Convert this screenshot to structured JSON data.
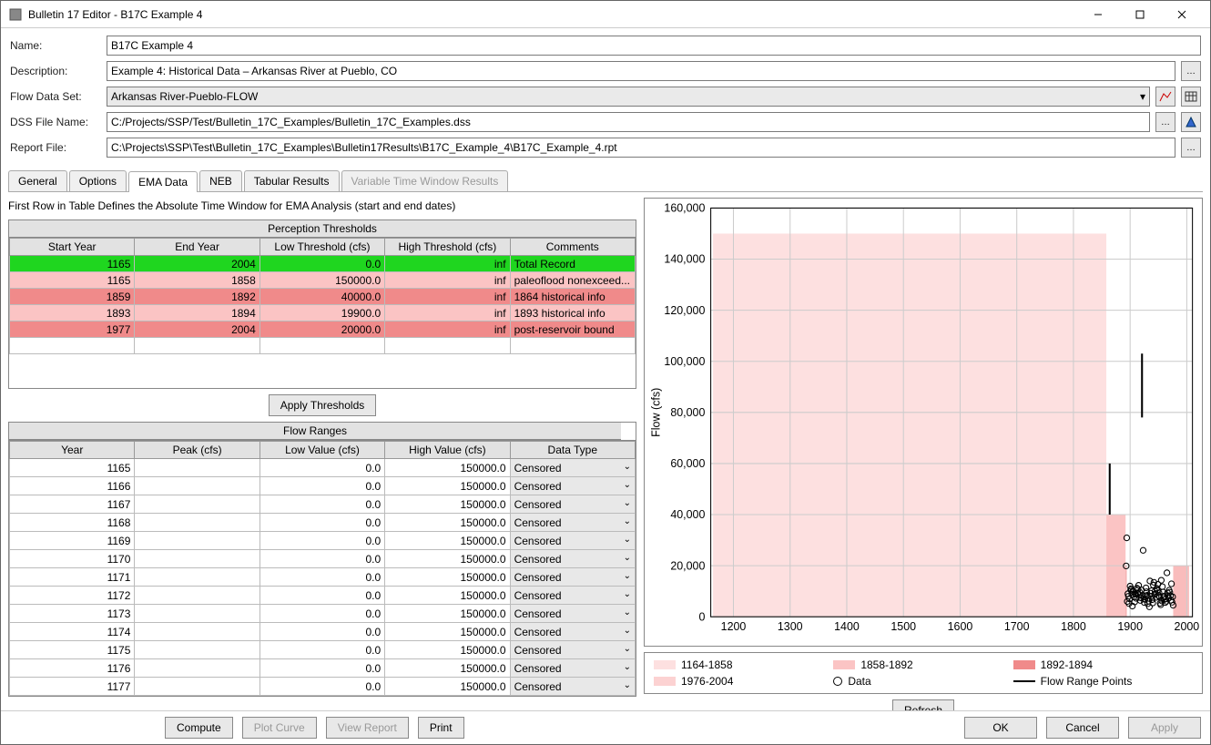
{
  "window": {
    "title": "Bulletin 17 Editor - B17C Example 4"
  },
  "form": {
    "name_label": "Name:",
    "name_value": "B17C Example 4",
    "desc_label": "Description:",
    "desc_value": "Example 4: Historical Data – Arkansas River at Pueblo, CO",
    "flowds_label": "Flow Data Set:",
    "flowds_value": "Arkansas River-Pueblo-FLOW",
    "dss_label": "DSS File Name:",
    "dss_value": "C:/Projects/SSP/Test/Bulletin_17C_Examples/Bulletin_17C_Examples.dss",
    "report_label": "Report File:",
    "report_value": "C:\\Projects\\SSP\\Test\\Bulletin_17C_Examples\\Bulletin17Results\\B17C_Example_4\\B17C_Example_4.rpt"
  },
  "tabs": {
    "t0": "General",
    "t1": "Options",
    "t2": "EMA Data",
    "t3": "NEB",
    "t4": "Tabular Results",
    "t5": "Variable Time Window Results"
  },
  "ema": {
    "caption": "First Row in Table Defines the Absolute Time Window for EMA Analysis (start and end dates)",
    "pt_title": "Perception Thresholds",
    "pt_headers": {
      "c0": "Start Year",
      "c1": "End Year",
      "c2": "Low Threshold (cfs)",
      "c3": "High Threshold (cfs)",
      "c4": "Comments"
    },
    "pt_rows": [
      {
        "sy": "1165",
        "ey": "2004",
        "lt": "0.0",
        "ht": "inf",
        "cm": "Total Record",
        "cls": "green"
      },
      {
        "sy": "1165",
        "ey": "1858",
        "lt": "150000.0",
        "ht": "inf",
        "cm": "paleoflood nonexceed...",
        "cls": "light"
      },
      {
        "sy": "1859",
        "ey": "1892",
        "lt": "40000.0",
        "ht": "inf",
        "cm": "1864 historical info",
        "cls": "darker"
      },
      {
        "sy": "1893",
        "ey": "1894",
        "lt": "19900.0",
        "ht": "inf",
        "cm": "1893 historical info",
        "cls": "light"
      },
      {
        "sy": "1977",
        "ey": "2004",
        "lt": "20000.0",
        "ht": "inf",
        "cm": "post-reservoir bound",
        "cls": "darker"
      }
    ],
    "apply_btn": "Apply Thresholds",
    "fr_title": "Flow Ranges",
    "fr_headers": {
      "c0": "Year",
      "c1": "Peak (cfs)",
      "c2": "Low Value (cfs)",
      "c3": "High Value (cfs)",
      "c4": "Data Type"
    },
    "fr_rows": [
      {
        "y": "1165",
        "p": "",
        "l": "0.0",
        "h": "150000.0",
        "dt": "Censored"
      },
      {
        "y": "1166",
        "p": "",
        "l": "0.0",
        "h": "150000.0",
        "dt": "Censored"
      },
      {
        "y": "1167",
        "p": "",
        "l": "0.0",
        "h": "150000.0",
        "dt": "Censored"
      },
      {
        "y": "1168",
        "p": "",
        "l": "0.0",
        "h": "150000.0",
        "dt": "Censored"
      },
      {
        "y": "1169",
        "p": "",
        "l": "0.0",
        "h": "150000.0",
        "dt": "Censored"
      },
      {
        "y": "1170",
        "p": "",
        "l": "0.0",
        "h": "150000.0",
        "dt": "Censored"
      },
      {
        "y": "1171",
        "p": "",
        "l": "0.0",
        "h": "150000.0",
        "dt": "Censored"
      },
      {
        "y": "1172",
        "p": "",
        "l": "0.0",
        "h": "150000.0",
        "dt": "Censored"
      },
      {
        "y": "1173",
        "p": "",
        "l": "0.0",
        "h": "150000.0",
        "dt": "Censored"
      },
      {
        "y": "1174",
        "p": "",
        "l": "0.0",
        "h": "150000.0",
        "dt": "Censored"
      },
      {
        "y": "1175",
        "p": "",
        "l": "0.0",
        "h": "150000.0",
        "dt": "Censored"
      },
      {
        "y": "1176",
        "p": "",
        "l": "0.0",
        "h": "150000.0",
        "dt": "Censored"
      },
      {
        "y": "1177",
        "p": "",
        "l": "0.0",
        "h": "150000.0",
        "dt": "Censored"
      }
    ]
  },
  "chart_data": {
    "type": "scatter",
    "ylabel": "Flow (cfs)",
    "xlim": [
      1160,
      2010
    ],
    "ylim": [
      0,
      160000
    ],
    "xticks": [
      1200,
      1300,
      1400,
      1500,
      1600,
      1700,
      1800,
      1900,
      2000
    ],
    "yticks": [
      0,
      20000,
      40000,
      60000,
      80000,
      100000,
      120000,
      140000,
      160000
    ],
    "ytick_labels": [
      "0",
      "20,000",
      "40,000",
      "60,000",
      "80,000",
      "100,000",
      "120,000",
      "140,000",
      "160,000"
    ],
    "bands": [
      {
        "name": "1164-1858",
        "x0": 1164,
        "x1": 1858,
        "y0": 0,
        "y1": 150000,
        "color": "#fde0e0"
      },
      {
        "name": "1858-1892",
        "x0": 1858,
        "x1": 1892,
        "y0": 0,
        "y1": 40000,
        "color": "#fbc4c4"
      },
      {
        "name": "1892-1894",
        "x0": 1892,
        "x1": 1894,
        "y0": 0,
        "y1": 19900,
        "color": "#f3a7a7"
      },
      {
        "name": "1976-2004",
        "x0": 1976,
        "x1": 2004,
        "y0": 0,
        "y1": 20000,
        "color": "#f9bcbc"
      }
    ],
    "range_lines": [
      {
        "x": 1864,
        "y0": 40000,
        "y1": 60000
      },
      {
        "x": 1921,
        "y0": 78000,
        "y1": 103000
      }
    ],
    "data_points": [
      {
        "x": 1893,
        "y": 19900
      },
      {
        "x": 1894,
        "y": 30900
      },
      {
        "x": 1895,
        "y": 6000
      },
      {
        "x": 1896,
        "y": 9000
      },
      {
        "x": 1897,
        "y": 8000
      },
      {
        "x": 1898,
        "y": 5200
      },
      {
        "x": 1899,
        "y": 7000
      },
      {
        "x": 1900,
        "y": 12000
      },
      {
        "x": 1901,
        "y": 10500
      },
      {
        "x": 1902,
        "y": 11000
      },
      {
        "x": 1903,
        "y": 8800
      },
      {
        "x": 1904,
        "y": 4200
      },
      {
        "x": 1905,
        "y": 10000
      },
      {
        "x": 1906,
        "y": 9800
      },
      {
        "x": 1907,
        "y": 7800
      },
      {
        "x": 1908,
        "y": 5800
      },
      {
        "x": 1909,
        "y": 9000
      },
      {
        "x": 1910,
        "y": 8800
      },
      {
        "x": 1911,
        "y": 7200
      },
      {
        "x": 1912,
        "y": 11200
      },
      {
        "x": 1913,
        "y": 9400
      },
      {
        "x": 1914,
        "y": 10800
      },
      {
        "x": 1915,
        "y": 12300
      },
      {
        "x": 1916,
        "y": 8700
      },
      {
        "x": 1917,
        "y": 9600
      },
      {
        "x": 1918,
        "y": 6400
      },
      {
        "x": 1919,
        "y": 7400
      },
      {
        "x": 1920,
        "y": 10500
      },
      {
        "x": 1922,
        "y": 8300
      },
      {
        "x": 1923,
        "y": 26000
      },
      {
        "x": 1924,
        "y": 7100
      },
      {
        "x": 1925,
        "y": 5600
      },
      {
        "x": 1926,
        "y": 6800
      },
      {
        "x": 1927,
        "y": 8200
      },
      {
        "x": 1928,
        "y": 11300
      },
      {
        "x": 1929,
        "y": 9800
      },
      {
        "x": 1930,
        "y": 8400
      },
      {
        "x": 1931,
        "y": 5100
      },
      {
        "x": 1932,
        "y": 7200
      },
      {
        "x": 1933,
        "y": 6100
      },
      {
        "x": 1934,
        "y": 3900
      },
      {
        "x": 1935,
        "y": 14000
      },
      {
        "x": 1936,
        "y": 9200
      },
      {
        "x": 1937,
        "y": 8000
      },
      {
        "x": 1938,
        "y": 10200
      },
      {
        "x": 1939,
        "y": 6700
      },
      {
        "x": 1940,
        "y": 5400
      },
      {
        "x": 1941,
        "y": 12400
      },
      {
        "x": 1942,
        "y": 13500
      },
      {
        "x": 1943,
        "y": 8800
      },
      {
        "x": 1944,
        "y": 10000
      },
      {
        "x": 1945,
        "y": 9100
      },
      {
        "x": 1946,
        "y": 7600
      },
      {
        "x": 1947,
        "y": 11100
      },
      {
        "x": 1948,
        "y": 10300
      },
      {
        "x": 1949,
        "y": 12700
      },
      {
        "x": 1950,
        "y": 8300
      },
      {
        "x": 1951,
        "y": 9400
      },
      {
        "x": 1952,
        "y": 7700
      },
      {
        "x": 1953,
        "y": 5300
      },
      {
        "x": 1954,
        "y": 4700
      },
      {
        "x": 1955,
        "y": 14300
      },
      {
        "x": 1956,
        "y": 6200
      },
      {
        "x": 1957,
        "y": 11800
      },
      {
        "x": 1958,
        "y": 9700
      },
      {
        "x": 1959,
        "y": 7500
      },
      {
        "x": 1960,
        "y": 8100
      },
      {
        "x": 1961,
        "y": 6800
      },
      {
        "x": 1962,
        "y": 5600
      },
      {
        "x": 1963,
        "y": 7000
      },
      {
        "x": 1964,
        "y": 6100
      },
      {
        "x": 1965,
        "y": 17200
      },
      {
        "x": 1966,
        "y": 9400
      },
      {
        "x": 1967,
        "y": 8100
      },
      {
        "x": 1968,
        "y": 7300
      },
      {
        "x": 1969,
        "y": 10400
      },
      {
        "x": 1970,
        "y": 9600
      },
      {
        "x": 1971,
        "y": 8200
      },
      {
        "x": 1972,
        "y": 6500
      },
      {
        "x": 1973,
        "y": 12900
      },
      {
        "x": 1974,
        "y": 5700
      },
      {
        "x": 1975,
        "y": 7800
      },
      {
        "x": 1976,
        "y": 4500
      }
    ]
  },
  "legend": {
    "i0": "1164-1858",
    "i1": "1858-1892",
    "i2": "1892-1894",
    "i3": "1976-2004",
    "i4": "Data",
    "i5": "Flow Range Points"
  },
  "buttons": {
    "refresh": "Refresh",
    "compute": "Compute",
    "plot": "Plot Curve",
    "view": "View Report",
    "print": "Print",
    "ok": "OK",
    "cancel": "Cancel",
    "apply": "Apply"
  }
}
